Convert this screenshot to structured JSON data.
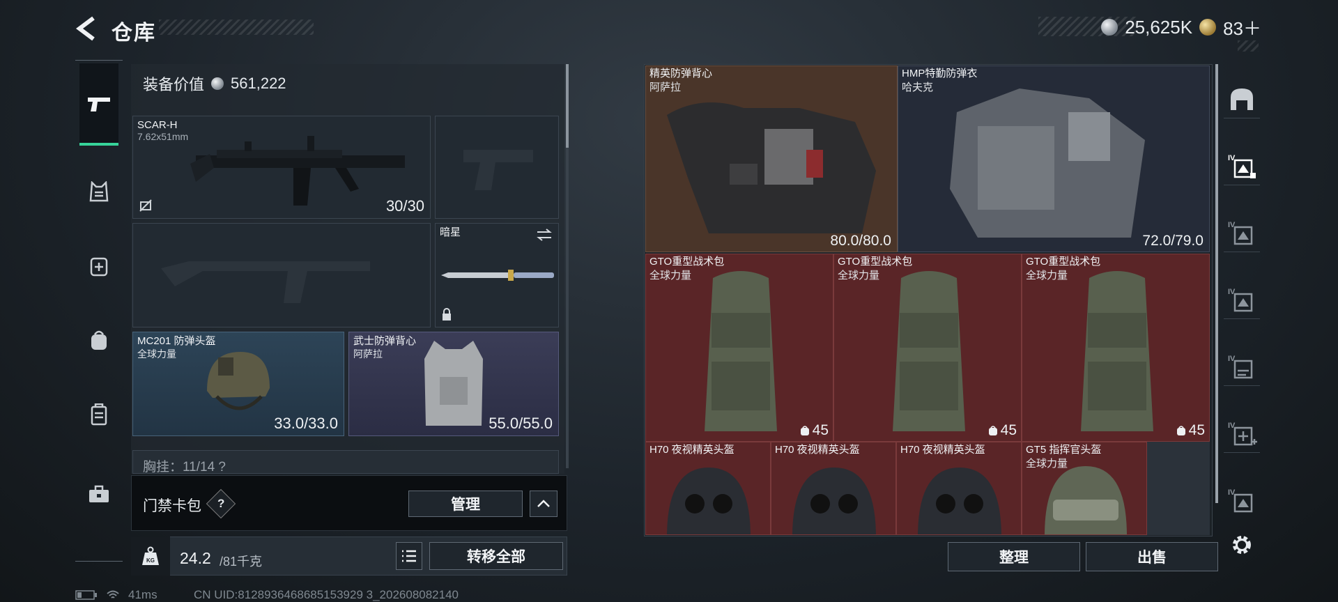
{
  "header": {
    "title": "仓库"
  },
  "currency": {
    "silver": "25,625K",
    "gold": "83＋"
  },
  "left_rail": {
    "icons": [
      "pistol-icon",
      "vest-icon",
      "backpack-medkit-icon",
      "backpack-icon",
      "case-icon",
      "toolbox-icon"
    ]
  },
  "loadout": {
    "value_label": "装备价值",
    "value": "561,222",
    "primary": {
      "name": "SCAR-H",
      "caliber": "7.62x51mm",
      "ammo": "30/30"
    },
    "melee": {
      "name": "暗星"
    },
    "helmet": {
      "name": "MC201 防弹头盔",
      "brand": "全球力量",
      "durability": "33.0/33.0"
    },
    "armor": {
      "name": "武士防弹背心",
      "brand": "阿萨拉",
      "durability": "55.0/55.0"
    },
    "chest_partial": "胸挂：11/14 ?"
  },
  "keycard": {
    "label": "门禁卡包",
    "help": "?",
    "manage_label": "管理"
  },
  "weight": {
    "current": "24.2",
    "max": "/81千克",
    "kg_badge": "KG",
    "transfer_label": "转移全部"
  },
  "status": {
    "ping": "41ms",
    "uid": "CN UID:8128936468685153929 3_202608082140"
  },
  "stash": {
    "items": [
      {
        "name": "精英防弹背心",
        "brand": "阿萨拉",
        "durability": "80.0/80.0"
      },
      {
        "name": "HMP特勤防弹衣",
        "brand": "哈夫克",
        "durability": "72.0/79.0"
      },
      {
        "name": "GTO重型战术包",
        "brand": "全球力量",
        "capacity": "45"
      },
      {
        "name": "GTO重型战术包",
        "brand": "全球力量",
        "capacity": "45"
      },
      {
        "name": "GTO重型战术包",
        "brand": "全球力量",
        "capacity": "45"
      },
      {
        "name": "H70 夜视精英头盔",
        "brand": ""
      },
      {
        "name": "H70 夜视精英头盔",
        "brand": ""
      },
      {
        "name": "H70 夜视精英头盔",
        "brand": ""
      },
      {
        "name": "GT5 指挥官头盔",
        "brand": "全球力量"
      }
    ],
    "tidy_label": "整理",
    "sell_label": "出售"
  },
  "right_rail": {
    "tier_label": "IV"
  },
  "colors": {
    "accent": "#37d49a",
    "rare_red": "#5a2527",
    "rare_brown": "#4a3529"
  }
}
